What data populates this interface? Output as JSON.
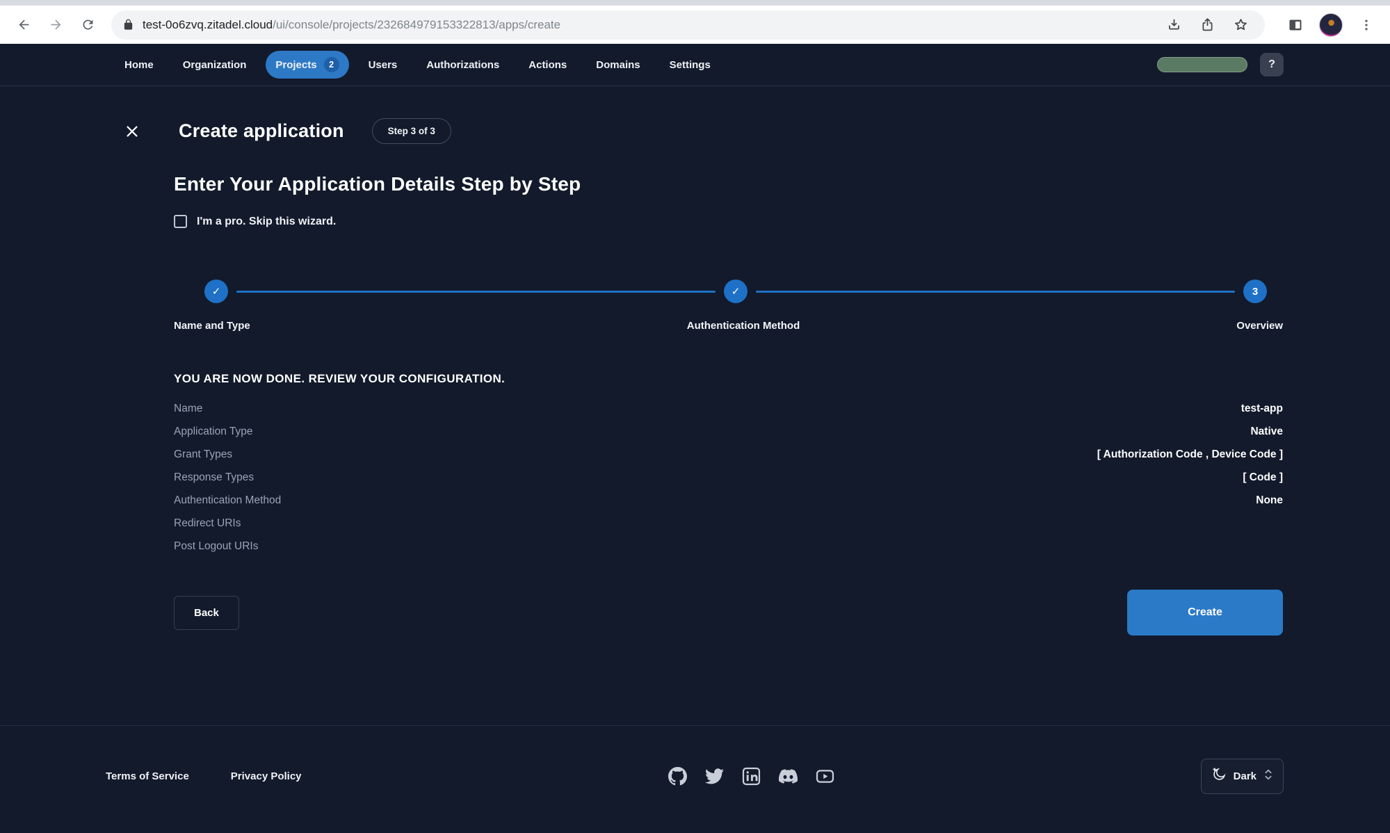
{
  "browser": {
    "url_domain": "test-0o6zvq.zitadel.cloud",
    "url_path": "/ui/console/projects/232684979153322813/apps/create"
  },
  "nav": {
    "items": [
      {
        "label": "Home",
        "active": false
      },
      {
        "label": "Organization",
        "active": false
      },
      {
        "label": "Projects",
        "active": true,
        "badge": "2"
      },
      {
        "label": "Users",
        "active": false
      },
      {
        "label": "Authorizations",
        "active": false
      },
      {
        "label": "Actions",
        "active": false
      },
      {
        "label": "Domains",
        "active": false
      },
      {
        "label": "Settings",
        "active": false
      }
    ],
    "help_label": "?"
  },
  "wizard": {
    "title": "Create application",
    "step_badge": "Step 3 of 3",
    "heading": "Enter Your Application Details Step by Step",
    "skip_label": "I'm a pro. Skip this wizard.",
    "skip_checked": false,
    "steps": [
      {
        "label": "Name and Type",
        "status": "done",
        "marker": "✓"
      },
      {
        "label": "Authentication Method",
        "status": "done",
        "marker": "✓"
      },
      {
        "label": "Overview",
        "status": "current",
        "marker": "3"
      }
    ],
    "review": {
      "title": "YOU ARE NOW DONE. REVIEW YOUR CONFIGURATION.",
      "rows": [
        {
          "label": "Name",
          "value": "test-app"
        },
        {
          "label": "Application Type",
          "value": "Native"
        },
        {
          "label": "Grant Types",
          "value": "[ Authorization Code , Device Code ]"
        },
        {
          "label": "Response Types",
          "value": "[ Code ]"
        },
        {
          "label": "Authentication Method",
          "value": "None"
        },
        {
          "label": "Redirect URIs",
          "value": ""
        },
        {
          "label": "Post Logout URIs",
          "value": ""
        }
      ]
    },
    "back_label": "Back",
    "create_label": "Create"
  },
  "footer": {
    "links": [
      {
        "label": "Terms of Service"
      },
      {
        "label": "Privacy Policy"
      }
    ],
    "social_icons": [
      "github-icon",
      "twitter-icon",
      "linkedin-icon",
      "discord-icon",
      "youtube-icon"
    ],
    "theme": {
      "label": "Dark"
    }
  },
  "colors": {
    "accent_blue": "#2b7ac8",
    "stepper_blue": "#1e71c6",
    "nav_active_blue": "#2e79c6",
    "page_background": "#121a2b",
    "skeleton_green": "#5b7a64"
  }
}
